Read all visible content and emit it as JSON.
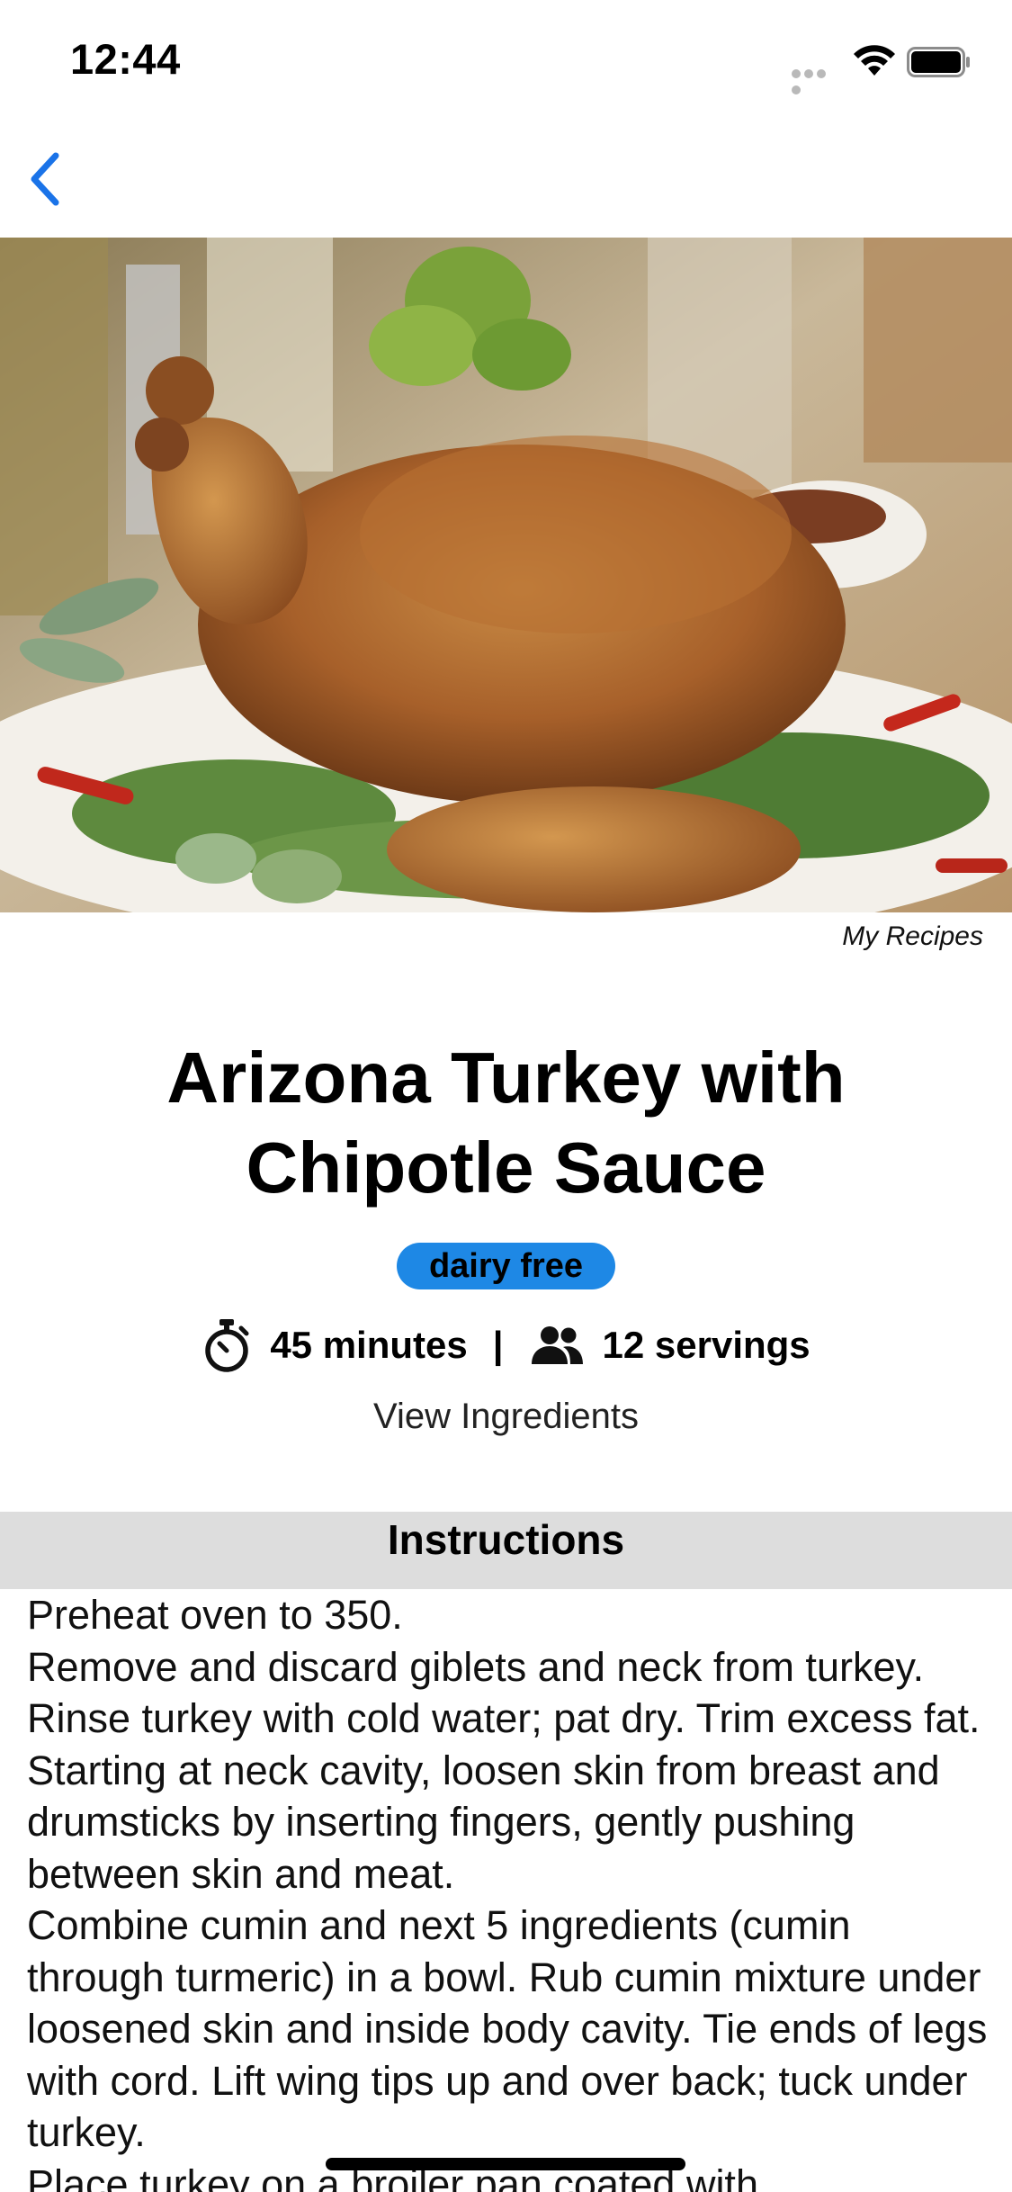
{
  "status_bar": {
    "time": "12:44",
    "icons": [
      "signal-dots-icon",
      "wifi-icon",
      "battery-icon"
    ]
  },
  "nav": {
    "back_icon": "chevron-left-icon",
    "accent_color": "#1a73e8"
  },
  "recipe": {
    "image_alt": "Roast turkey on a platter with herbs and chili peppers",
    "credit": "My Recipes",
    "title": "Arizona Turkey with Chipotle Sauce",
    "badge": "dairy free",
    "badge_color": "#1e88e5",
    "time": "45 minutes",
    "separator": "|",
    "servings": "12 servings",
    "view_ingredients": "View Ingredients",
    "time_icon": "stopwatch-icon",
    "servings_icon": "people-icon"
  },
  "instructions": {
    "header": "Instructions",
    "steps": [
      "Preheat oven to 350.",
      "Remove and discard giblets and neck from turkey. Rinse turkey with cold water; pat dry. Trim excess fat. Starting at neck cavity, loosen skin from breast and drumsticks by inserting fingers, gently pushing between skin and meat.",
      "Combine cumin and next 5 ingredients (cumin through turmeric) in a bowl. Rub cumin mixture under loosened skin and inside body cavity. Tie ends of legs with cord. Lift wing tips up and over back; tuck under turkey.",
      "Place turkey on a broiler pan coated with"
    ]
  }
}
